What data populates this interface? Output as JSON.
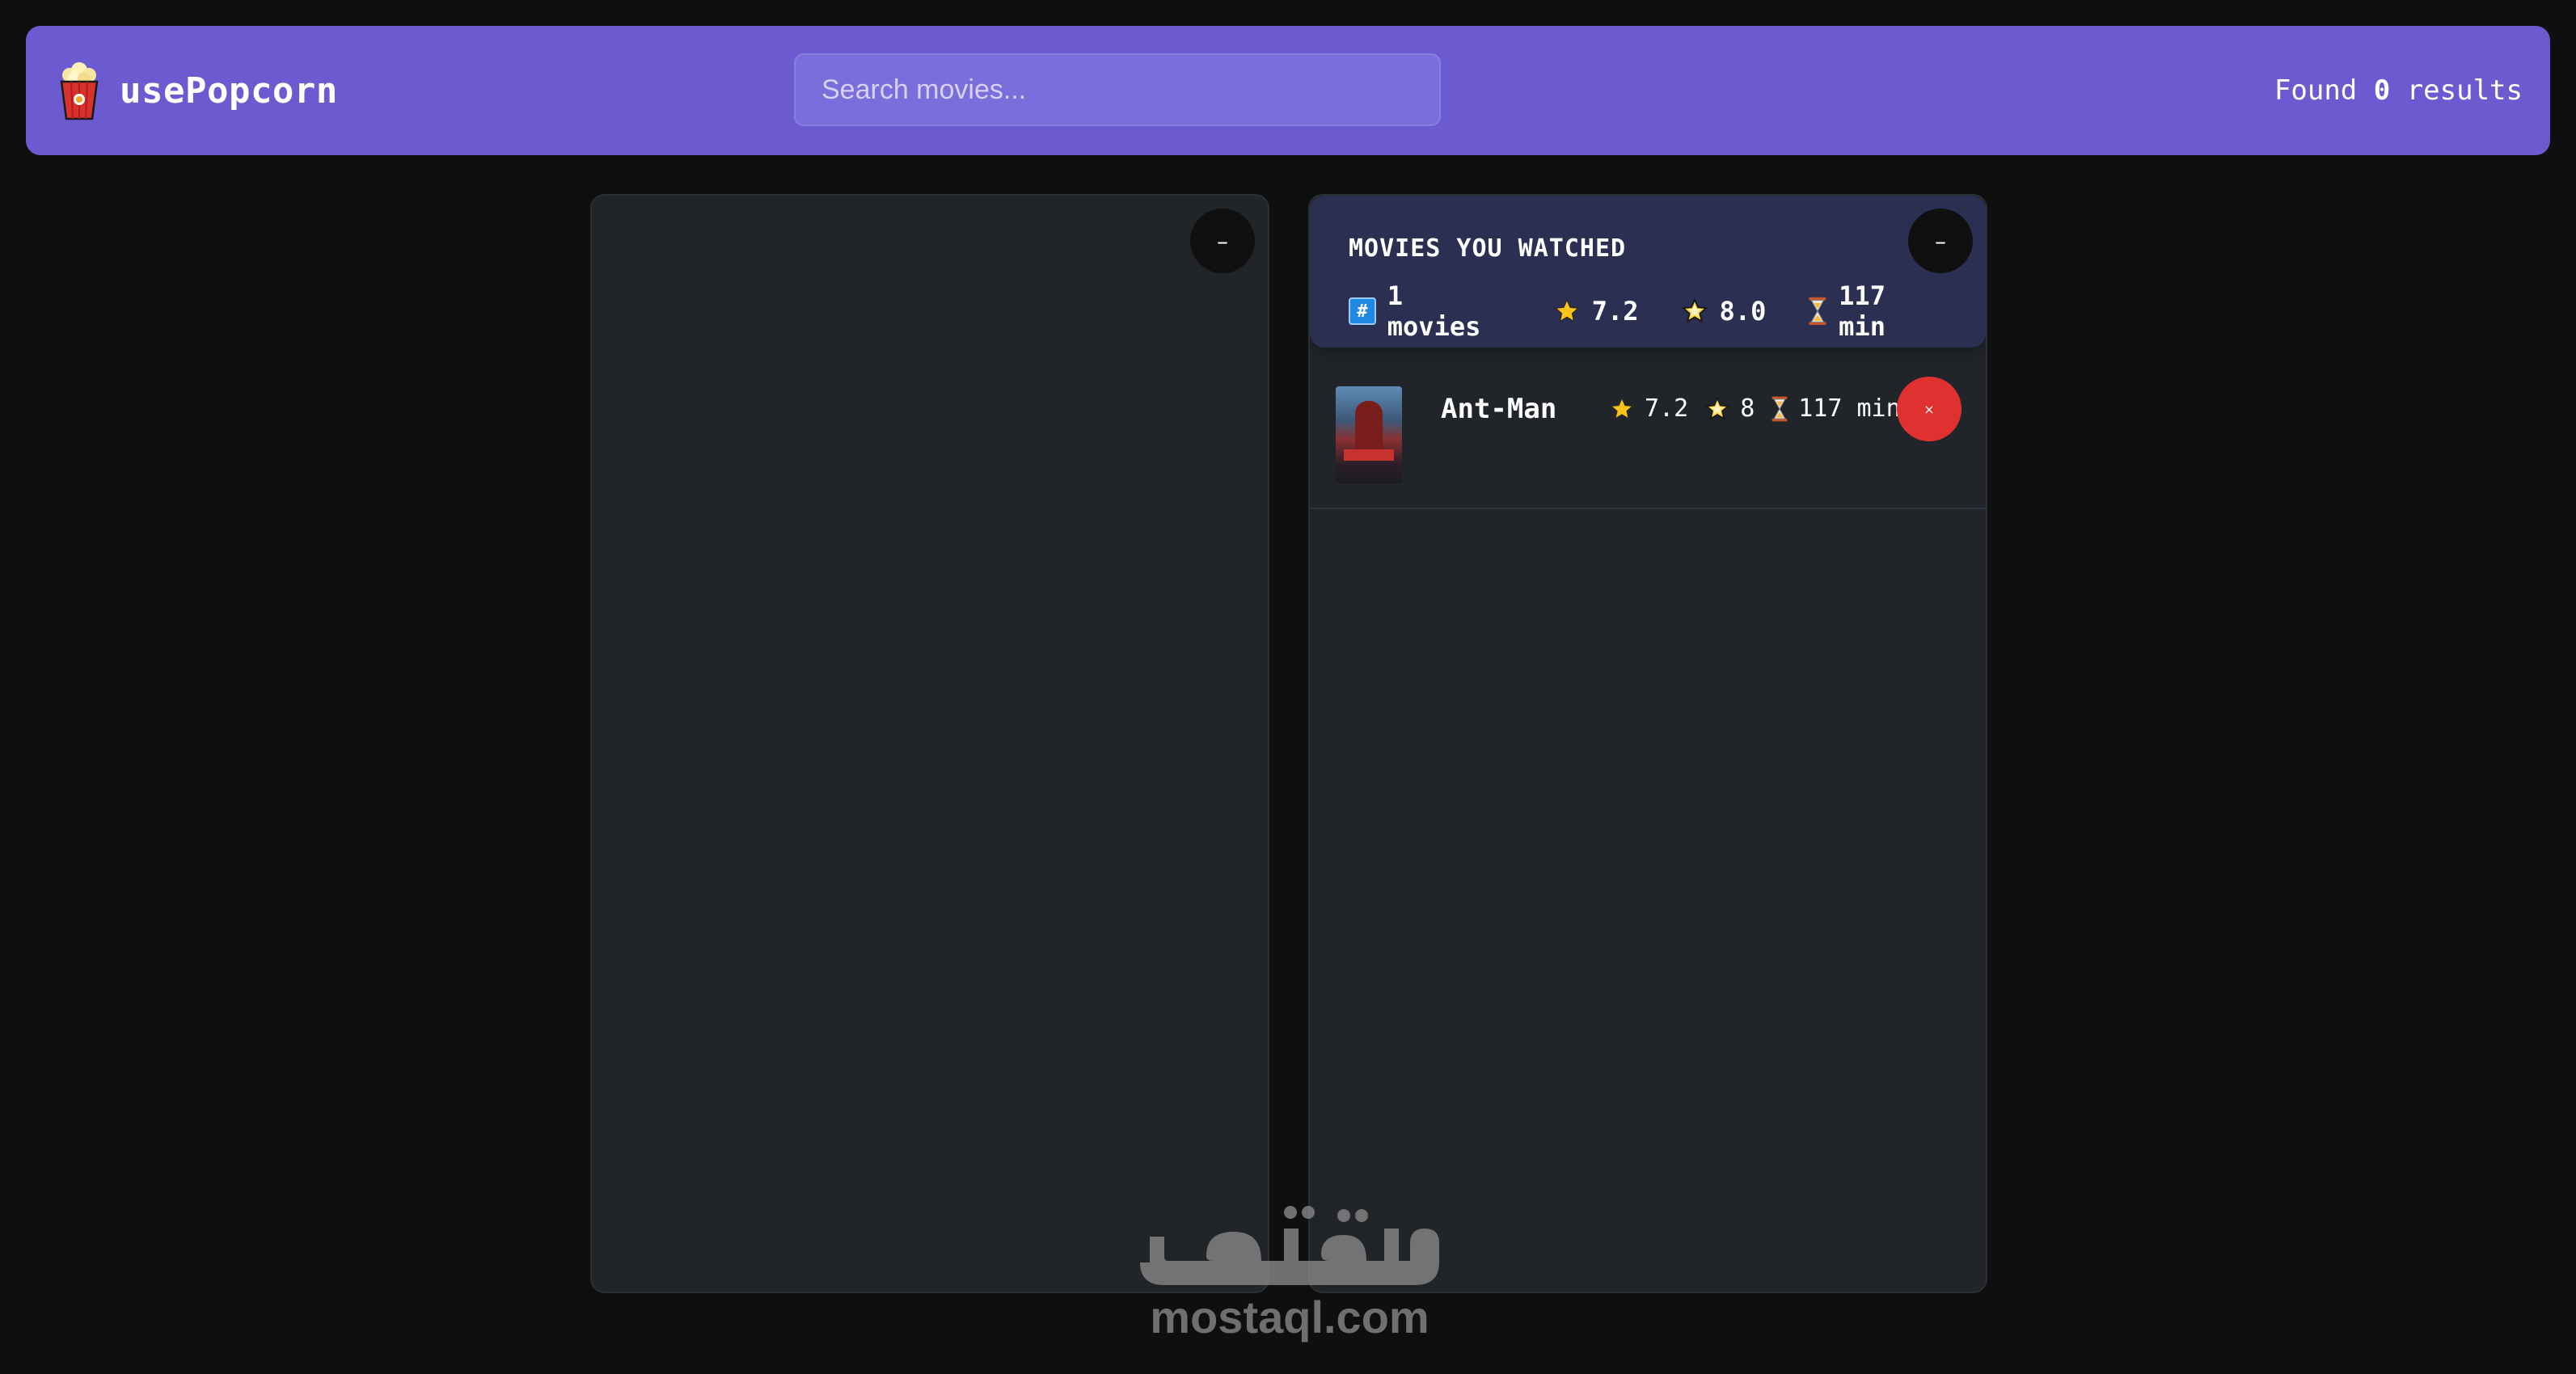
{
  "app": {
    "name": "usePopcorn",
    "logo_icon": "popcorn-icon"
  },
  "search": {
    "placeholder": "Search movies...",
    "value": ""
  },
  "results": {
    "prefix": "Found ",
    "count": "0",
    "suffix": " results"
  },
  "left_box": {
    "toggle_label": "–"
  },
  "watched": {
    "toggle_label": "–",
    "title": "MOVIES YOU WATCHED",
    "stats": {
      "movies": "1 movies",
      "avg_imdb": "7.2",
      "avg_user": "8.0",
      "avg_runtime": "117 min"
    },
    "icons": {
      "count": "hash-icon",
      "imdb": "star-icon",
      "user": "glowing-star-icon",
      "runtime": "hourglass-icon"
    },
    "movies": [
      {
        "title": "Ant-Man",
        "imdb_rating": "7.2",
        "user_rating": "8",
        "runtime": "117 min",
        "delete_label": "×"
      }
    ]
  },
  "watermark": {
    "arabic": "مستقل",
    "latin": "mostaql.com"
  },
  "colors": {
    "background": "#0f0f0f",
    "nav": "#6c5bd0",
    "box": "#212529",
    "summary": "#2b3052",
    "delete": "#e03131"
  }
}
